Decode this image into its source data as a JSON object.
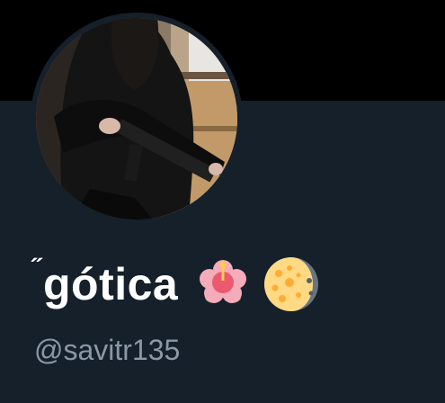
{
  "profile": {
    "name_prefix": "˝",
    "display_name": "gótica",
    "handle": "@savitr135",
    "emojis": [
      "hibiscus-icon",
      "waning-gibbous-moon-icon"
    ]
  },
  "colors": {
    "banner": "#000000",
    "background": "#15202b",
    "name": "#ffffff",
    "handle": "#8b98a5"
  }
}
